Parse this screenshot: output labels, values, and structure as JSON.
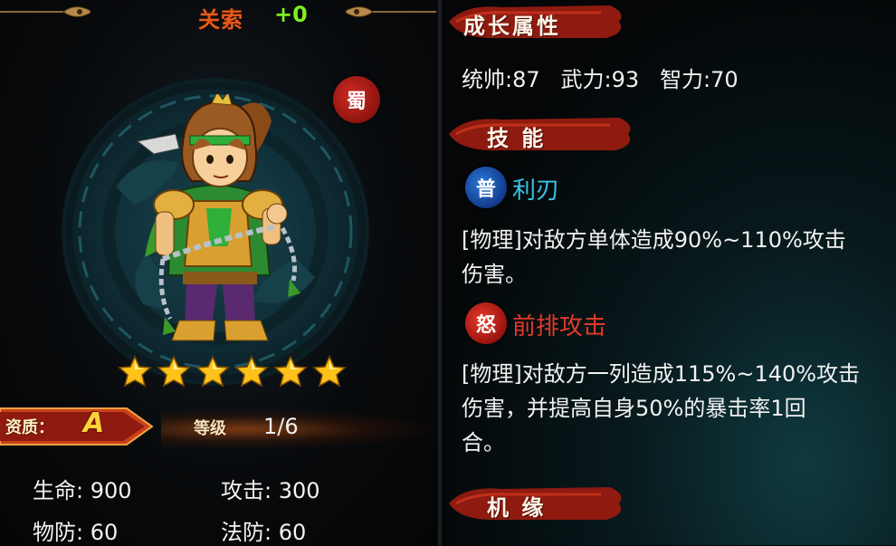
{
  "header": {
    "hero_name": "关索",
    "enhance_level": "+0"
  },
  "hero": {
    "faction": "蜀",
    "star_count": 6,
    "quality_label": "资质：",
    "quality_grade": "A",
    "level_label": "等级",
    "level_value": "1/6"
  },
  "stats": {
    "hp_label": "生命:",
    "hp_value": "900",
    "atk_label": "攻击:",
    "atk_value": "300",
    "pdef_label": "物防:",
    "pdef_value": "60",
    "mdef_label": "法防:",
    "mdef_value": "60"
  },
  "growth": {
    "title": "成长属性",
    "command_label": "统帅:",
    "command_value": "87",
    "force_label": "武力:",
    "force_value": "93",
    "intel_label": "智力:",
    "intel_value": "70"
  },
  "skills": {
    "title": "技 能",
    "normal": {
      "icon_char": "普",
      "name": "利刃",
      "desc_line1": "[物理]对敌方单体造成90%~110%攻击",
      "desc_line2": "伤害。"
    },
    "rage": {
      "icon_char": "怒",
      "name": "前排攻击",
      "desc_line1": "[物理]对敌方一列造成115%~140%攻击",
      "desc_line2": "伤害，并提高自身50%的暴击率1回",
      "desc_line3": "合。"
    }
  },
  "fate": {
    "title": "机 缘"
  },
  "colors": {
    "name_orange": "#e85a1a",
    "plus_green": "#7ef01e",
    "normal_skill_cyan": "#39c6e6",
    "rage_skill_red": "#e23a2a",
    "banner_red": "#8e1a10",
    "star_gold": "#ffc21a"
  }
}
